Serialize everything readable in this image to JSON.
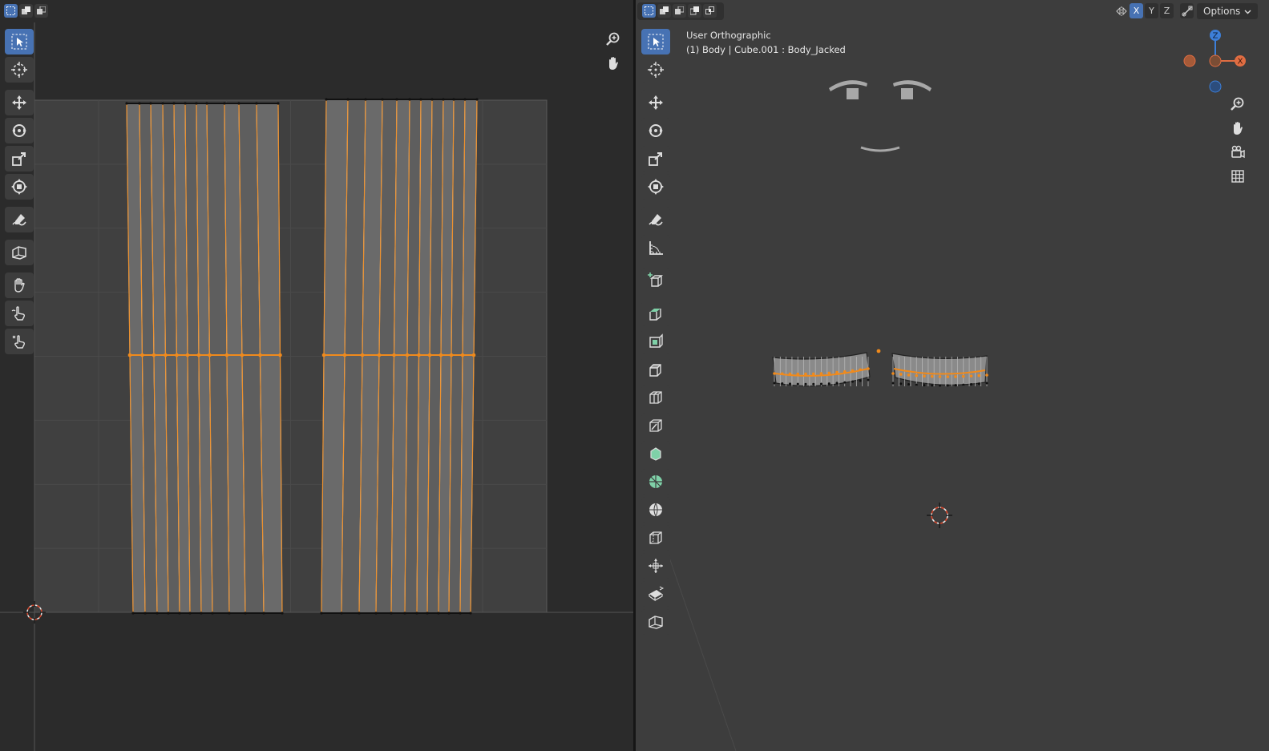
{
  "uv_editor": {
    "header": {
      "select_modes": [
        "select-box-icon",
        "select-extend-icon",
        "select-subtract-icon"
      ]
    },
    "toolbar": [
      "select-box-icon",
      "cursor-icon",
      "move-icon",
      "rotate-icon",
      "scale-icon",
      "transform-icon",
      "annotate-icon",
      "rip-region-icon",
      "grab-icon",
      "relax-icon",
      "pinch-icon"
    ],
    "nav": [
      "zoom-icon",
      "pan-icon"
    ]
  },
  "viewport": {
    "header": {
      "select_modes": [
        "select-box-icon",
        "select-extend-icon",
        "select-subtract-icon",
        "select-invert-icon",
        "select-intersect-icon"
      ],
      "mirror_axes": [
        "X",
        "Y",
        "Z"
      ],
      "active_axis": "X",
      "options_label": "Options"
    },
    "info": {
      "view_name": "User Orthographic",
      "object_line": "(1) Body | Cube.001 : Body_Jacked"
    },
    "gizmo": {
      "axes": [
        "Z",
        "X"
      ],
      "colors": {
        "x": "#e06d42",
        "y": "#6fa33a",
        "z": "#3d7fd8"
      }
    },
    "nav": [
      "zoom-icon",
      "pan-icon",
      "camera-icon",
      "grid-icon"
    ],
    "toolbar": [
      "select-box-icon",
      "cursor-icon",
      "move-icon",
      "rotate-icon",
      "scale-icon",
      "transform-icon",
      "annotate-icon",
      "measure-icon",
      "add-cube-icon",
      "extrude-icon",
      "inset-icon",
      "bevel-icon",
      "loop-cut-icon",
      "knife-icon",
      "poly-build-icon",
      "spin-icon",
      "smooth-icon",
      "edge-slide-icon",
      "shrink-fatten-icon",
      "shear-icon",
      "rip-icon"
    ]
  },
  "colors": {
    "accent": "#4772b3",
    "selection": "#f08a1c",
    "uv_background": "#2b2b2b",
    "viewport_background": "#3d3d3d"
  }
}
